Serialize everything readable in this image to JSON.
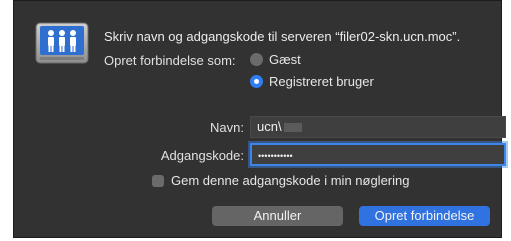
{
  "dialog": {
    "title": "Skriv navn og adgangskode til serveren “filer02-skn.ucn.moc”.",
    "connect_as_label": "Opret forbindelse som:",
    "options": [
      {
        "label": "Gæst",
        "selected": false
      },
      {
        "label": "Registreret bruger",
        "selected": true
      }
    ],
    "name_label": "Navn:",
    "name_value": "ucn\\",
    "password_label": "Adgangskode:",
    "password_value": "•••••••••••",
    "remember_label": "Gem denne adgangskode i min nøglering",
    "remember_checked": false,
    "cancel_label": "Annuller",
    "connect_label": "Opret forbindelse"
  },
  "colors": {
    "dialog_bg": "#323232",
    "accent": "#2f72e0",
    "focus_ring": "#3b86e8"
  },
  "icons": {
    "server": "network-server-people-icon"
  }
}
